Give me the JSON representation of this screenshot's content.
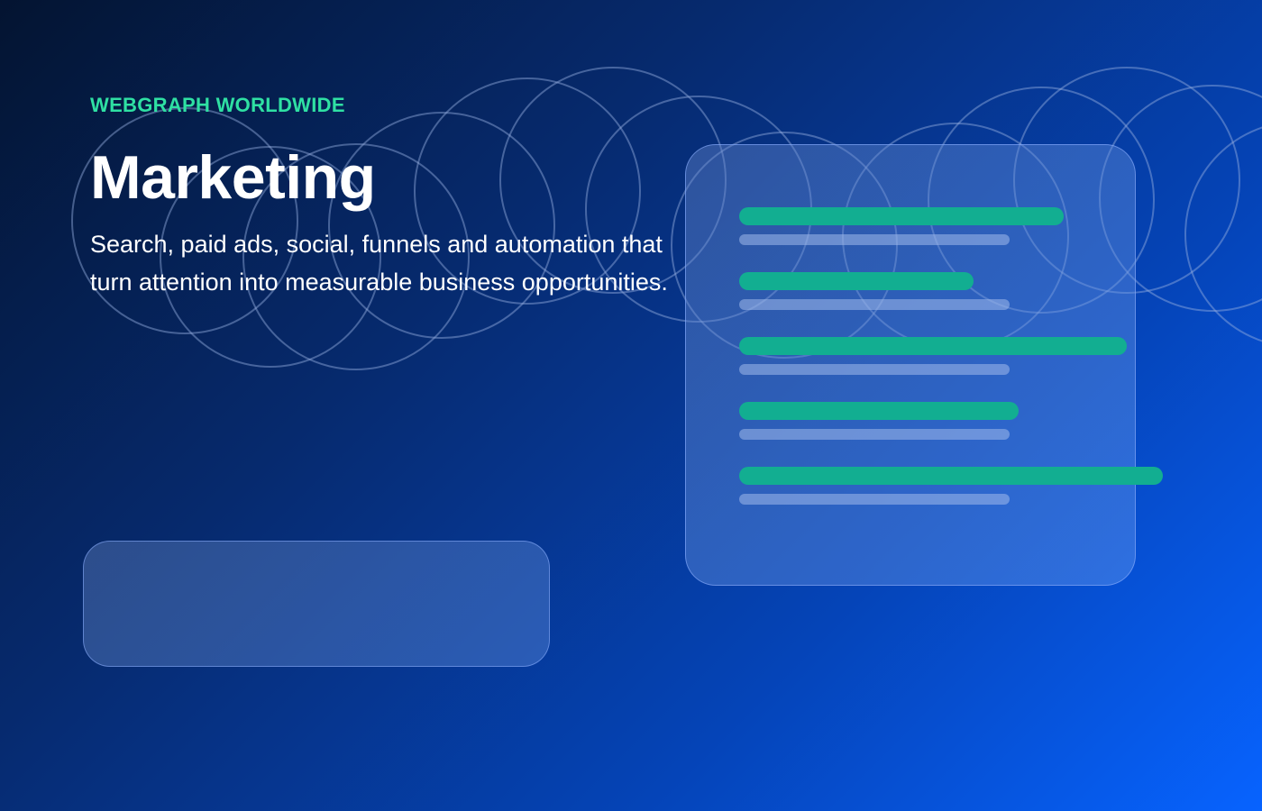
{
  "hero": {
    "eyebrow": "WEBGRAPH WORLDWIDE",
    "title": "Marketing",
    "lead": "Search, paid ads, social, funnels and automation that turn attention into measurable business opportunities."
  },
  "colors": {
    "accent": "#2fe0a3",
    "bar": "#12ae91",
    "background_start": "#041431",
    "background_end": "#0763ff"
  },
  "panel": {
    "bars": [
      {
        "level": 0.84
      },
      {
        "level": 0.61
      },
      {
        "level": 1.0
      },
      {
        "level": 0.72
      },
      {
        "level": 1.09
      }
    ]
  }
}
